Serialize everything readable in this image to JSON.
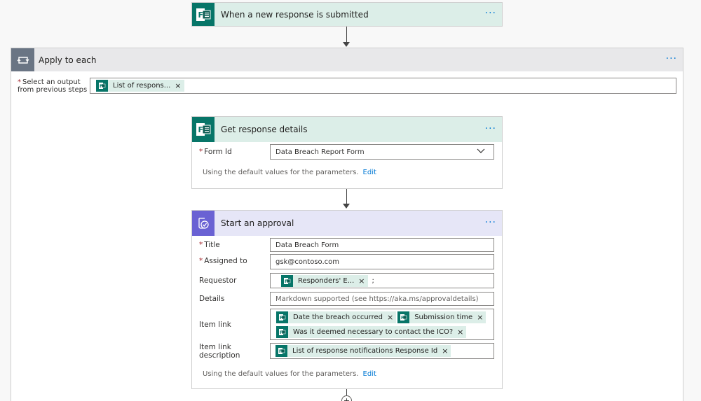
{
  "trigger": {
    "title": "When a new response is submitted",
    "icon": "forms-icon",
    "menu": "···"
  },
  "apply_to_each": {
    "title": "Apply to each",
    "icon": "loop-icon",
    "menu": "···",
    "select_label_line1": "Select an output",
    "select_label_line2": "from previous steps",
    "required_mark": "*",
    "token": "List of respons...",
    "remove": "×"
  },
  "get_details": {
    "title": "Get response details",
    "menu": "···",
    "form_id_label": "Form Id",
    "required_mark": "*",
    "form_id_value": "Data Breach Report Form",
    "defaults_text": "Using the default values for the parameters.",
    "edit_label": "Edit"
  },
  "approval": {
    "title": "Start an approval",
    "icon": "approval-icon",
    "menu": "···",
    "required_mark": "*",
    "title_label": "Title",
    "title_value": "Data Breach Form",
    "assigned_label": "Assigned to",
    "assigned_value": "gsk@contoso.com",
    "requestor_label": "Requestor",
    "requestor_token": "Responders' E...",
    "requestor_suffix": ";",
    "details_label": "Details",
    "details_placeholder": "Markdown supported (see https://aka.ms/approvaldetails)",
    "item_link_label": "Item link",
    "item_link_tokens": [
      "Date the breach occurred",
      "Submission time",
      "Was it deemed necessary to contact the ICO?"
    ],
    "item_link_desc_label": "Item link description",
    "item_link_desc_token": "List of response notifications Response Id",
    "remove": "×",
    "defaults_text": "Using the default values for the parameters.",
    "edit_label": "Edit"
  },
  "add_step": "+",
  "colors": {
    "forms_green": "#077568",
    "forms_header": "#dceee8",
    "approval_purple": "#6a62d3",
    "approval_header": "#e6e6f7",
    "link_blue": "#0078d4",
    "required_red": "#a4262c"
  }
}
